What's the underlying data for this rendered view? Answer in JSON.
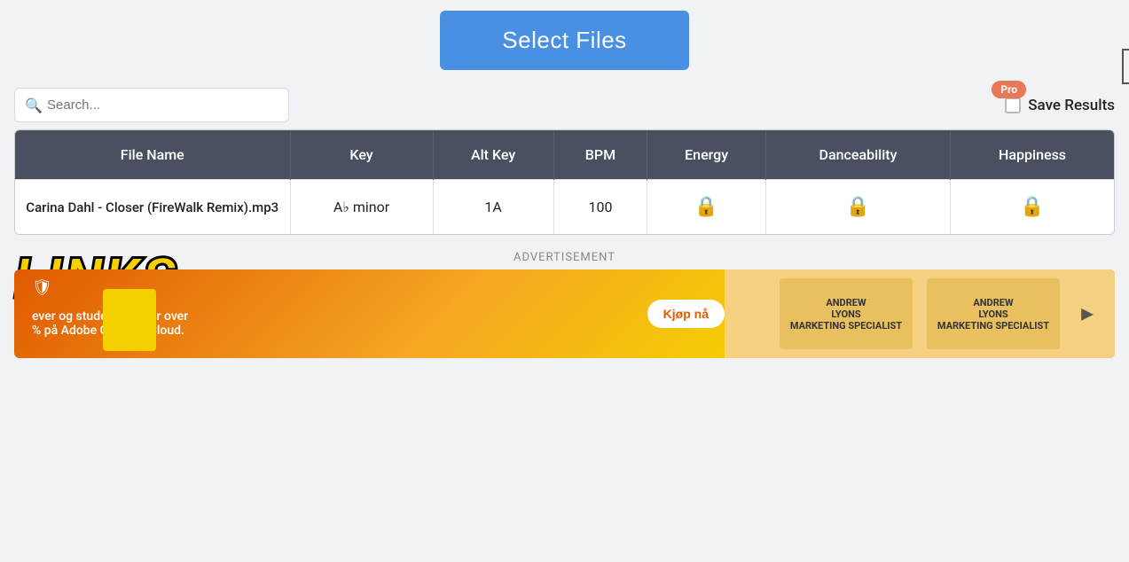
{
  "header": {
    "select_files_label": "Select Files"
  },
  "search": {
    "placeholder": "Search..."
  },
  "pro_badge": {
    "label": "Pro"
  },
  "save_results": {
    "label": "Save Results"
  },
  "table": {
    "columns": [
      {
        "id": "file_name",
        "label": "File Name"
      },
      {
        "id": "key",
        "label": "Key"
      },
      {
        "id": "alt_key",
        "label": "Alt Key"
      },
      {
        "id": "bpm",
        "label": "BPM"
      },
      {
        "id": "energy",
        "label": "Energy"
      },
      {
        "id": "danceability",
        "label": "Danceability"
      },
      {
        "id": "happiness",
        "label": "Happiness"
      }
    ],
    "rows": [
      {
        "file_name": "Carina Dahl - Closer (FireWalk Remix).mp3",
        "key": "A♭ minor",
        "alt_key": "1A",
        "bpm": "100",
        "energy": "lock",
        "danceability": "lock",
        "happiness": "lock"
      }
    ]
  },
  "advertisement": {
    "label": "ADVERTISEMENT",
    "ad_text_line1": "ever og studenter: Spar over",
    "ad_text_line2": "% på Adobe Creative Cloud.",
    "ad_button": "Kjøp nå",
    "person1_name": "ANDREW",
    "person1_title": "LYONS",
    "person1_sub": "MARKETING SPECIALIST",
    "person2_name": "ANDREW",
    "person2_title": "LYONS",
    "person2_sub": "MARKETING SPECIALIST"
  },
  "links_banner": {
    "text": "LINKS"
  },
  "icons": {
    "search": "🔍",
    "lock": "🔒",
    "shield": "🛡",
    "expand": "▶"
  }
}
